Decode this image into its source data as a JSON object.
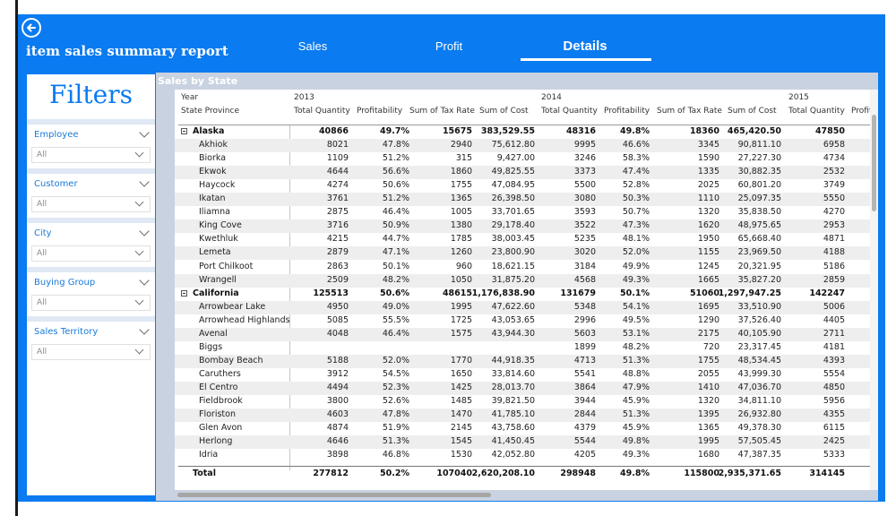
{
  "header": {
    "title": "item sales summary report",
    "tabs": [
      {
        "label": "Sales"
      },
      {
        "label": "Profit"
      },
      {
        "label": "Details"
      }
    ]
  },
  "filters": {
    "title": "Filters",
    "items": [
      {
        "label": "Employee",
        "value": "All"
      },
      {
        "label": "Customer",
        "value": "All"
      },
      {
        "label": "City",
        "value": "All"
      },
      {
        "label": "Buying Group",
        "value": "All"
      },
      {
        "label": "Sales Territory",
        "value": "All"
      }
    ]
  },
  "table": {
    "title": "Sales by State",
    "year_label": "Year",
    "row_header": "State Province",
    "years": [
      "2013",
      "2014",
      "2015"
    ],
    "columns": [
      "Total Quantity",
      "Profitability",
      "Sum of Tax Rate",
      "Sum of Cost",
      "Total Quantity",
      "Profitability",
      "Sum of Tax Rate",
      "Sum of Cost",
      "Total Quantity",
      "Profit"
    ],
    "rows": [
      {
        "name": "Alaska",
        "group": true,
        "cells": [
          "40866",
          "49.7%",
          "15675",
          "383,529.55",
          "48316",
          "49.8%",
          "18360",
          "465,420.50",
          "47850"
        ]
      },
      {
        "name": "Akhiok",
        "cells": [
          "8021",
          "47.8%",
          "2940",
          "75,612.80",
          "9995",
          "46.6%",
          "3345",
          "90,811.10",
          "6958"
        ]
      },
      {
        "name": "Biorka",
        "cells": [
          "1109",
          "51.2%",
          "315",
          "9,427.00",
          "3246",
          "58.3%",
          "1590",
          "27,227.30",
          "4734"
        ]
      },
      {
        "name": "Ekwok",
        "cells": [
          "4644",
          "56.6%",
          "1860",
          "49,825.55",
          "3373",
          "47.4%",
          "1335",
          "30,882.35",
          "2532"
        ]
      },
      {
        "name": "Haycock",
        "cells": [
          "4274",
          "50.6%",
          "1755",
          "47,084.95",
          "5500",
          "52.8%",
          "2025",
          "60,801.20",
          "3749"
        ]
      },
      {
        "name": "Ikatan",
        "cells": [
          "3761",
          "51.2%",
          "1365",
          "26,398.50",
          "3080",
          "50.3%",
          "1110",
          "25,097.35",
          "5550"
        ]
      },
      {
        "name": "Iliamna",
        "cells": [
          "2875",
          "46.4%",
          "1005",
          "33,701.65",
          "3593",
          "50.7%",
          "1320",
          "35,838.50",
          "4270"
        ]
      },
      {
        "name": "King Cove",
        "cells": [
          "3716",
          "50.9%",
          "1380",
          "29,178.40",
          "3522",
          "47.3%",
          "1620",
          "48,975.65",
          "2953"
        ]
      },
      {
        "name": "Kwethluk",
        "cells": [
          "4215",
          "44.7%",
          "1785",
          "38,003.45",
          "5235",
          "48.1%",
          "1950",
          "65,668.40",
          "4871"
        ]
      },
      {
        "name": "Lemeta",
        "cells": [
          "2879",
          "47.1%",
          "1260",
          "23,800.90",
          "3020",
          "52.0%",
          "1155",
          "23,969.50",
          "4188"
        ]
      },
      {
        "name": "Port Chilkoot",
        "cells": [
          "2863",
          "50.1%",
          "960",
          "18,621.15",
          "3184",
          "49.9%",
          "1245",
          "20,321.95",
          "5186"
        ]
      },
      {
        "name": "Wrangell",
        "cells": [
          "2509",
          "48.2%",
          "1050",
          "31,875.20",
          "4568",
          "49.3%",
          "1665",
          "35,827.20",
          "2859"
        ]
      },
      {
        "name": "California",
        "group": true,
        "cells": [
          "125513",
          "50.6%",
          "48615",
          "1,176,838.90",
          "131679",
          "50.1%",
          "51060",
          "1,297,947.25",
          "142247"
        ]
      },
      {
        "name": "Arrowbear Lake",
        "cells": [
          "4950",
          "49.0%",
          "1995",
          "47,622.60",
          "5348",
          "54.1%",
          "1695",
          "33,510.90",
          "5006"
        ]
      },
      {
        "name": "Arrowhead Highlands",
        "cells": [
          "5085",
          "55.5%",
          "1725",
          "43,053.65",
          "2996",
          "49.5%",
          "1290",
          "37,526.40",
          "4405"
        ]
      },
      {
        "name": "Avenal",
        "cells": [
          "4048",
          "46.4%",
          "1575",
          "43,944.30",
          "5603",
          "53.1%",
          "2175",
          "40,105.90",
          "2711"
        ]
      },
      {
        "name": "Biggs",
        "cells": [
          "",
          "",
          "",
          "",
          "1899",
          "48.2%",
          "720",
          "23,317.45",
          "4181"
        ]
      },
      {
        "name": "Bombay Beach",
        "cells": [
          "5188",
          "52.0%",
          "1770",
          "44,918.35",
          "4713",
          "51.3%",
          "1755",
          "48,534.45",
          "4393"
        ]
      },
      {
        "name": "Caruthers",
        "cells": [
          "3912",
          "54.5%",
          "1650",
          "33,814.60",
          "5541",
          "48.8%",
          "2055",
          "43,999.30",
          "5554"
        ]
      },
      {
        "name": "El Centro",
        "cells": [
          "4494",
          "52.3%",
          "1425",
          "28,013.70",
          "3864",
          "47.9%",
          "1410",
          "47,036.70",
          "4850"
        ]
      },
      {
        "name": "Fieldbrook",
        "cells": [
          "3800",
          "52.6%",
          "1485",
          "39,821.50",
          "3944",
          "45.9%",
          "1320",
          "34,811.10",
          "5956"
        ]
      },
      {
        "name": "Floriston",
        "cells": [
          "4603",
          "47.8%",
          "1470",
          "41,785.10",
          "2844",
          "51.3%",
          "1395",
          "26,932.80",
          "4355"
        ]
      },
      {
        "name": "Glen Avon",
        "cells": [
          "4874",
          "51.9%",
          "2145",
          "43,758.60",
          "4379",
          "45.9%",
          "1365",
          "49,378.30",
          "6115"
        ]
      },
      {
        "name": "Herlong",
        "cells": [
          "4646",
          "51.3%",
          "1545",
          "41,450.45",
          "5544",
          "49.8%",
          "1995",
          "57,505.45",
          "2425"
        ]
      },
      {
        "name": "Idria",
        "cells": [
          "3898",
          "46.8%",
          "1530",
          "42,052.80",
          "4205",
          "49.3%",
          "1680",
          "47,387.35",
          "5333"
        ]
      }
    ],
    "total": {
      "name": "Total",
      "cells": [
        "277812",
        "50.2%",
        "107040",
        "2,620,208.10",
        "298948",
        "49.8%",
        "115800",
        "2,935,371.65",
        "314145"
      ]
    }
  }
}
